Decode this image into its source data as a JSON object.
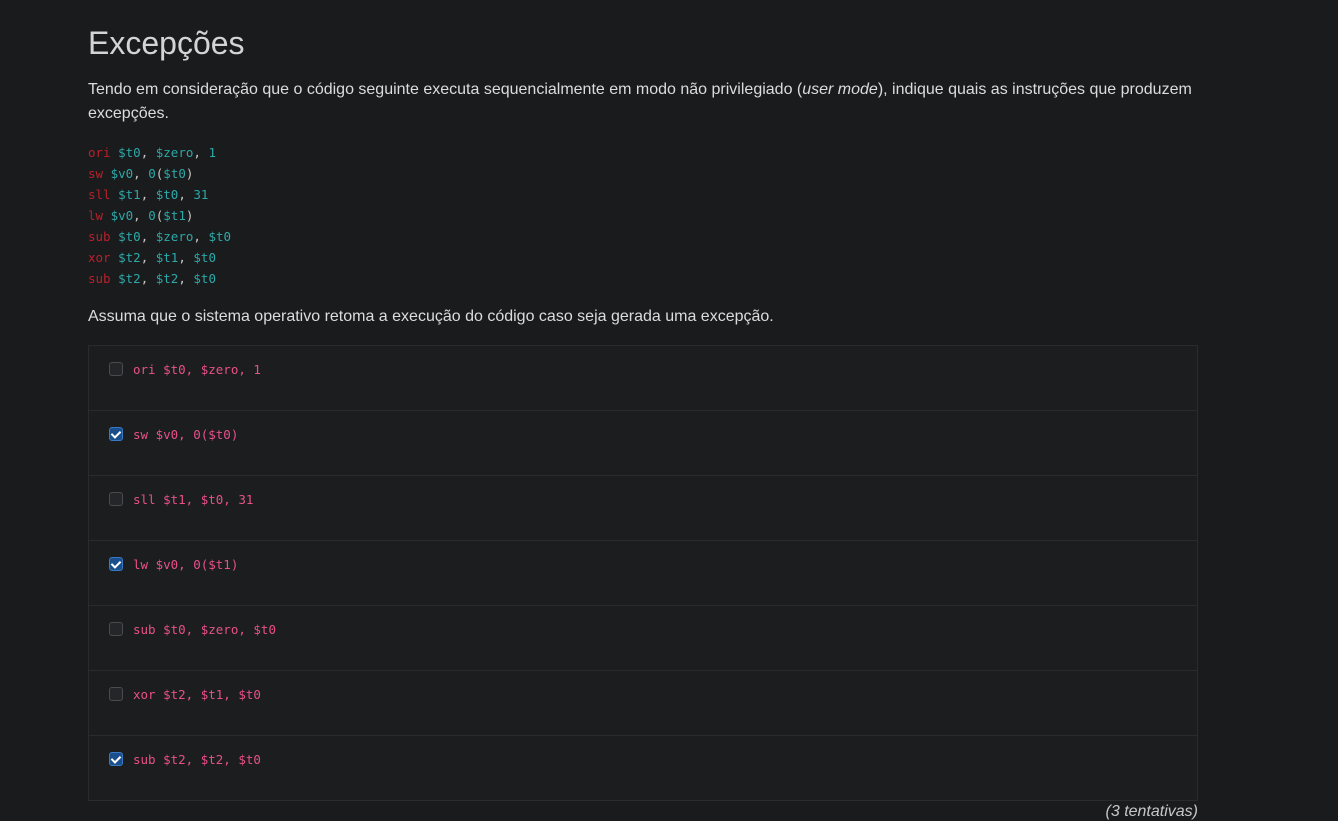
{
  "title": "Excepções",
  "intro": {
    "before": "Tendo em consideração que o código seguinte executa sequencialmente em modo não privilegiado (",
    "emph": "user mode",
    "after": "), indique quais as instruções que produzem excepções."
  },
  "code_lines": [
    {
      "op": "ori",
      "args": [
        {
          "t": "reg",
          "v": "$t0"
        },
        {
          "t": "punc",
          "v": ", "
        },
        {
          "t": "reg",
          "v": "$zero"
        },
        {
          "t": "punc",
          "v": ", "
        },
        {
          "t": "num",
          "v": "1"
        }
      ]
    },
    {
      "op": "sw",
      "args": [
        {
          "t": "reg",
          "v": "$v0"
        },
        {
          "t": "punc",
          "v": ", "
        },
        {
          "t": "num",
          "v": "0"
        },
        {
          "t": "punc",
          "v": "("
        },
        {
          "t": "reg",
          "v": "$t0"
        },
        {
          "t": "punc",
          "v": ")"
        }
      ]
    },
    {
      "op": "sll",
      "args": [
        {
          "t": "reg",
          "v": "$t1"
        },
        {
          "t": "punc",
          "v": ", "
        },
        {
          "t": "reg",
          "v": "$t0"
        },
        {
          "t": "punc",
          "v": ", "
        },
        {
          "t": "num",
          "v": "31"
        }
      ]
    },
    {
      "op": "lw",
      "args": [
        {
          "t": "reg",
          "v": "$v0"
        },
        {
          "t": "punc",
          "v": ", "
        },
        {
          "t": "num",
          "v": "0"
        },
        {
          "t": "punc",
          "v": "("
        },
        {
          "t": "reg",
          "v": "$t1"
        },
        {
          "t": "punc",
          "v": ")"
        }
      ]
    },
    {
      "op": "sub",
      "args": [
        {
          "t": "reg",
          "v": "$t0"
        },
        {
          "t": "punc",
          "v": ", "
        },
        {
          "t": "reg",
          "v": "$zero"
        },
        {
          "t": "punc",
          "v": ", "
        },
        {
          "t": "reg",
          "v": "$t0"
        }
      ]
    },
    {
      "op": "xor",
      "args": [
        {
          "t": "reg",
          "v": "$t2"
        },
        {
          "t": "punc",
          "v": ", "
        },
        {
          "t": "reg",
          "v": "$t1"
        },
        {
          "t": "punc",
          "v": ", "
        },
        {
          "t": "reg",
          "v": "$t0"
        }
      ]
    },
    {
      "op": "sub",
      "args": [
        {
          "t": "reg",
          "v": "$t2"
        },
        {
          "t": "punc",
          "v": ", "
        },
        {
          "t": "reg",
          "v": "$t2"
        },
        {
          "t": "punc",
          "v": ", "
        },
        {
          "t": "reg",
          "v": "$t0"
        }
      ]
    }
  ],
  "assume": "Assuma que o sistema operativo retoma a execução do código caso seja gerada uma excepção.",
  "options": [
    {
      "label": "ori $t0, $zero, 1",
      "checked": false
    },
    {
      "label": "sw $v0, 0($t0)",
      "checked": true
    },
    {
      "label": "sll $t1, $t0, 31",
      "checked": false
    },
    {
      "label": "lw $v0, 0($t1)",
      "checked": true
    },
    {
      "label": "sub $t0, $zero, $t0",
      "checked": false
    },
    {
      "label": "xor $t2, $t1, $t0",
      "checked": false
    },
    {
      "label": "sub $t2, $t2, $t0",
      "checked": true
    }
  ],
  "attempts": "(3 tentativas)",
  "colors": {
    "background": "#1a1b1d",
    "keyword": "#b8202a",
    "register": "#2ea8a8",
    "option_text": "#e8508a",
    "checkbox_checked": "#1b4f8c"
  }
}
